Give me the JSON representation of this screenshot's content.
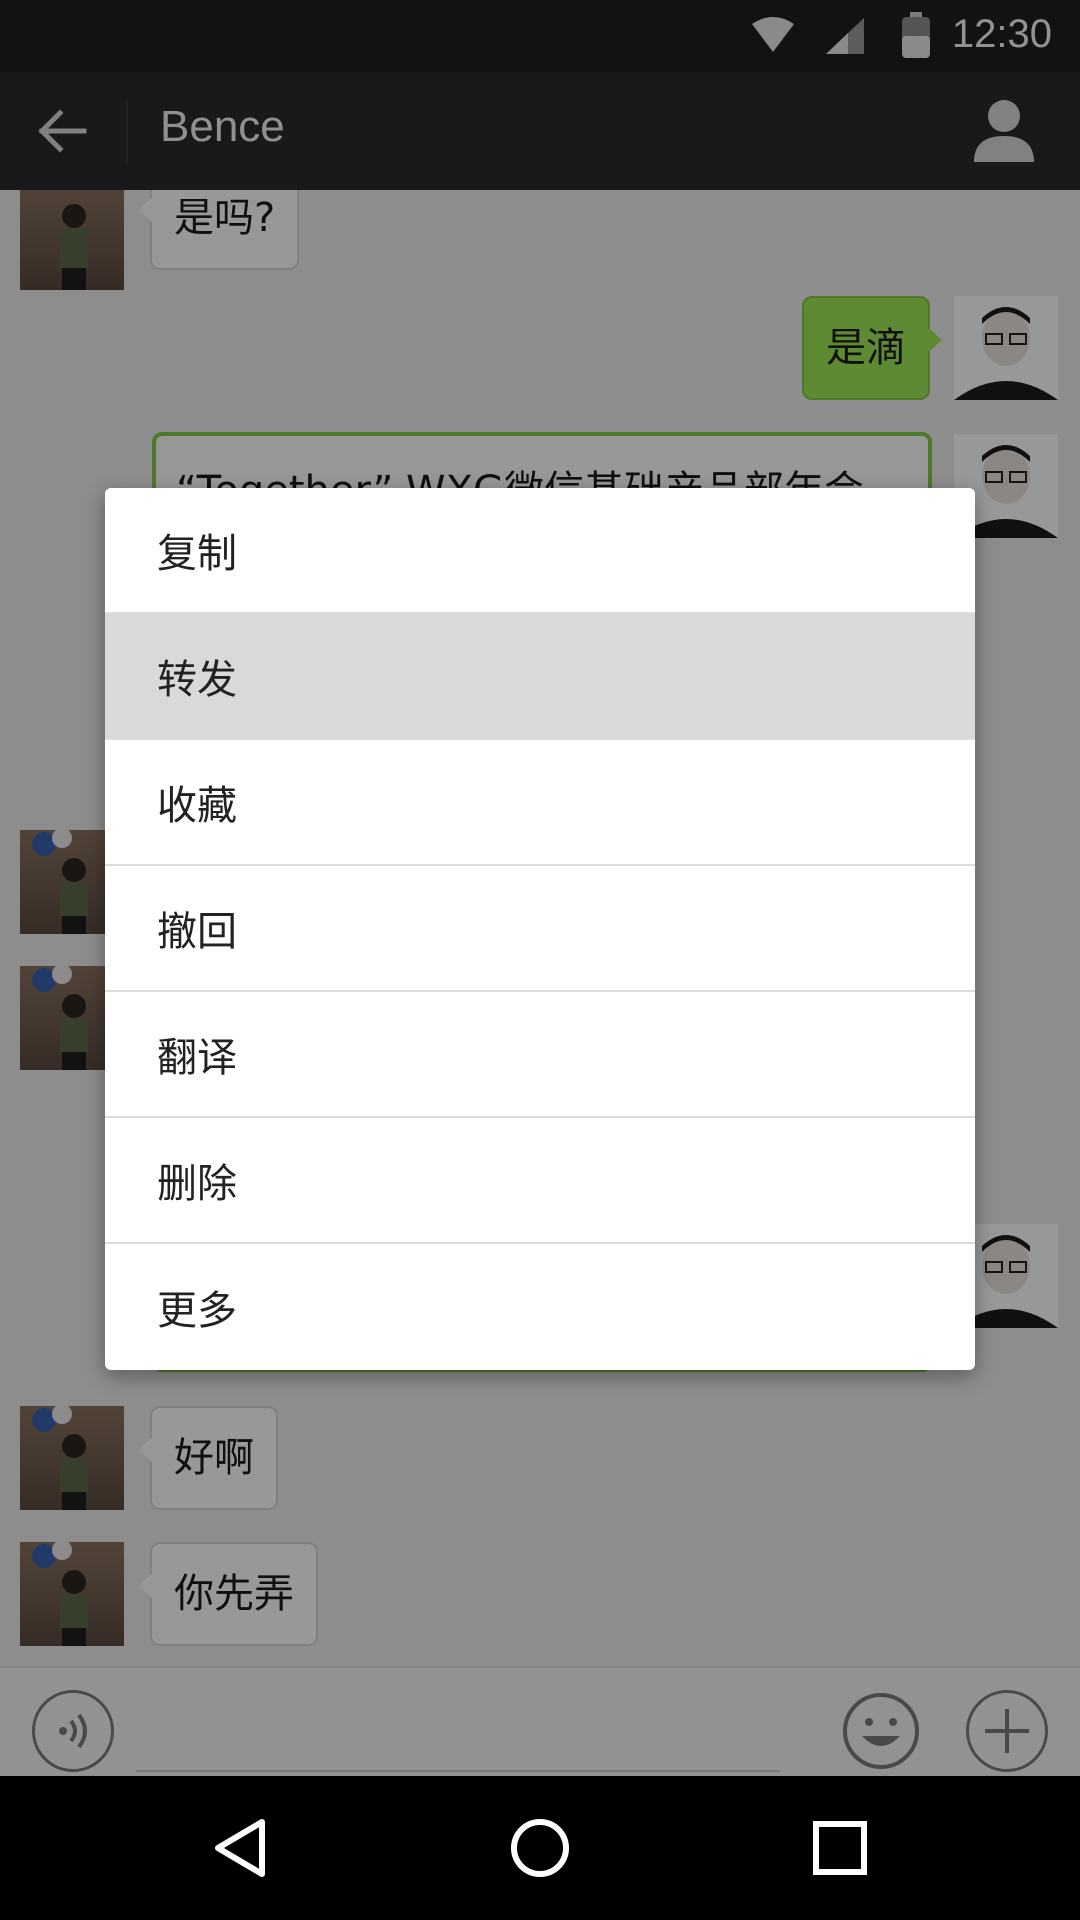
{
  "status_bar": {
    "time": "12:30",
    "icons": [
      "wifi-icon",
      "signal-icon",
      "battery-icon"
    ]
  },
  "title_bar": {
    "title": "Bence",
    "back_icon": "arrow-left-icon",
    "profile_icon": "person-icon"
  },
  "messages": [
    {
      "side": "left",
      "text": "是吗?"
    },
    {
      "side": "right",
      "text": "是滴"
    },
    {
      "side": "right",
      "type": "card",
      "text": "“Together” WXG微信基础产品部年会"
    },
    {
      "side": "left",
      "text": "好啊"
    },
    {
      "side": "left",
      "text": "你先弄"
    }
  ],
  "context_menu": {
    "items": [
      "复制",
      "转发",
      "收藏",
      "撤回",
      "翻译",
      "删除",
      "更多"
    ],
    "pressed_index": 1
  },
  "input_bar": {
    "icons": [
      "voice-icon",
      "emoji-icon",
      "plus-icon"
    ]
  },
  "nav_bar": {
    "icons": [
      "back-triangle-icon",
      "home-circle-icon",
      "recents-square-icon"
    ]
  },
  "colors": {
    "title_bar": "#2b2b2e",
    "bubble_sent": "#9fe658",
    "bubble_received": "#fdfdfd",
    "chat_bg": "#ebebeb"
  }
}
